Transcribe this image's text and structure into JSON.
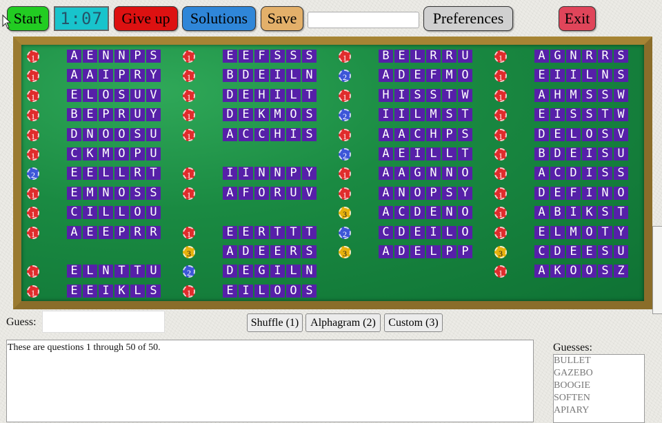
{
  "toolbar": {
    "start": "Start",
    "timer": "1:07",
    "give_up": "Give up",
    "solutions": "Solutions",
    "save": "Save",
    "search_value": "",
    "preferences": "Preferences",
    "exit": "Exit"
  },
  "colors": {
    "start": "#22cc22",
    "give_up": "#dd1111",
    "solutions": "#2f86d8",
    "save": "#e3b06a",
    "preferences": "#d0d0d0",
    "exit": "#e0455a",
    "tile": "#5620a8",
    "board_felt": "#1a8a42",
    "board_frame": "#8a6d2a"
  },
  "board": {
    "columns": [
      [
        {
          "chip": "1",
          "letters": "AENNPS"
        },
        {
          "chip": "1",
          "letters": "AAIPRY"
        },
        {
          "chip": "1",
          "letters": "ELOSUV"
        },
        {
          "chip": "1",
          "letters": "BEPRUY"
        },
        {
          "chip": "1",
          "letters": "DNOOSU"
        },
        {
          "chip": "1",
          "letters": "CKMOPU"
        },
        {
          "chip": "2",
          "letters": "EELLRT"
        },
        {
          "chip": "1",
          "letters": "EMNOSS"
        },
        {
          "chip": "1",
          "letters": "CILLOU"
        },
        {
          "chip": "1",
          "letters": "AEEPRR"
        },
        null,
        {
          "chip": "1",
          "letters": "ELNTTU"
        },
        {
          "chip": "1",
          "letters": "EEIKLS"
        }
      ],
      [
        {
          "chip": "1",
          "letters": "EEFSSS"
        },
        {
          "chip": "1",
          "letters": "BDEILN"
        },
        {
          "chip": "1",
          "letters": "DEHILT"
        },
        {
          "chip": "1",
          "letters": "DEKMOS"
        },
        {
          "chip": "1",
          "letters": "ACCHIS"
        },
        null,
        {
          "chip": "1",
          "letters": "IINNPY"
        },
        {
          "chip": "1",
          "letters": "AFORUV"
        },
        null,
        {
          "chip": "1",
          "letters": "EERTTT"
        },
        {
          "chip": "3",
          "letters": "ADEERS"
        },
        {
          "chip": "2",
          "letters": "DEGILN"
        },
        {
          "chip": "1",
          "letters": "EILOOS"
        }
      ],
      [
        {
          "chip": "1",
          "letters": "BELRRU"
        },
        {
          "chip": "2",
          "letters": "ADEFMO"
        },
        {
          "chip": "1",
          "letters": "HISSTW"
        },
        {
          "chip": "2",
          "letters": "IILMST"
        },
        {
          "chip": "1",
          "letters": "AACHPS"
        },
        {
          "chip": "2",
          "letters": "AEILLT"
        },
        {
          "chip": "1",
          "letters": "AAGNNO"
        },
        {
          "chip": "1",
          "letters": "ANOPSY"
        },
        {
          "chip": "3",
          "letters": "ACDENO"
        },
        {
          "chip": "2",
          "letters": "CDEILO"
        },
        {
          "chip": "3",
          "letters": "ADELPP"
        },
        null,
        null
      ],
      [
        {
          "chip": "1",
          "letters": "AGNRRS"
        },
        {
          "chip": "1",
          "letters": "EIILNS"
        },
        {
          "chip": "1",
          "letters": "AHMSSW"
        },
        {
          "chip": "1",
          "letters": "EISSTW"
        },
        {
          "chip": "1",
          "letters": "DELOSV"
        },
        {
          "chip": "1",
          "letters": "BDEISU"
        },
        {
          "chip": "1",
          "letters": "ACDISS"
        },
        {
          "chip": "1",
          "letters": "DEFINO"
        },
        {
          "chip": "1",
          "letters": "ABIKST"
        },
        {
          "chip": "1",
          "letters": "ELMOTY"
        },
        {
          "chip": "3",
          "letters": "CDEESU"
        },
        {
          "chip": "1",
          "letters": "AKOOSZ"
        },
        null
      ]
    ]
  },
  "guess": {
    "label": "Guess:",
    "value": ""
  },
  "controls": {
    "shuffle": "Shuffle (1)",
    "alphagram": "Alphagram (2)",
    "custom": "Custom (3)"
  },
  "message": "These are questions 1 through 50 of 50.",
  "guesses": {
    "label": "Guesses:",
    "items": [
      "BULLET",
      "GAZEBO",
      "BOOGIE",
      "SOFTEN",
      "APIARY"
    ]
  }
}
